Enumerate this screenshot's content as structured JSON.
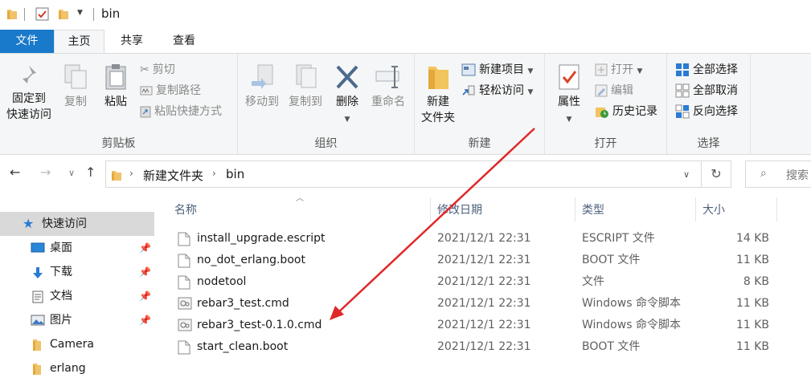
{
  "window": {
    "title": "bin"
  },
  "tabs": [
    {
      "label": "文件"
    },
    {
      "label": "主页"
    },
    {
      "label": "共享"
    },
    {
      "label": "查看"
    }
  ],
  "ribbon": {
    "clipboard": {
      "group_label": "剪贴板",
      "pin_quick_access_line1": "固定到",
      "pin_quick_access_line2": "快速访问",
      "copy": "复制",
      "paste": "粘贴",
      "cut": "剪切",
      "copy_path": "复制路径",
      "paste_shortcut": "粘贴快捷方式"
    },
    "organize": {
      "group_label": "组织",
      "move_to": "移动到",
      "copy_to": "复制到",
      "delete": "删除",
      "rename": "重命名"
    },
    "new": {
      "group_label": "新建",
      "new_folder_line1": "新建",
      "new_folder_line2": "文件夹",
      "new_item": "新建项目",
      "easy_access": "轻松访问"
    },
    "open": {
      "group_label": "打开",
      "properties": "属性",
      "open": "打开",
      "edit": "编辑",
      "history": "历史记录"
    },
    "select": {
      "group_label": "选择",
      "select_all": "全部选择",
      "select_none": "全部取消",
      "invert_selection": "反向选择"
    }
  },
  "address": {
    "crumbs": [
      "新建文件夹",
      "bin"
    ]
  },
  "search": {
    "placeholder": "搜索"
  },
  "sidebar": {
    "items": [
      {
        "label": "快速访问",
        "icon": "star-icon"
      },
      {
        "label": "桌面",
        "icon": "desktop-icon",
        "pinned": true
      },
      {
        "label": "下载",
        "icon": "download-icon",
        "pinned": true
      },
      {
        "label": "文档",
        "icon": "document-icon",
        "pinned": true
      },
      {
        "label": "图片",
        "icon": "picture-icon",
        "pinned": true
      },
      {
        "label": "Camera",
        "icon": "folder-icon"
      },
      {
        "label": "erlang",
        "icon": "folder-icon"
      }
    ]
  },
  "columns": {
    "name": "名称",
    "date": "修改日期",
    "type": "类型",
    "size": "大小"
  },
  "files": [
    {
      "name": "install_upgrade.escript",
      "date": "2021/12/1 22:31",
      "type": "ESCRIPT 文件",
      "size": "14 KB",
      "icon": "file-icon"
    },
    {
      "name": "no_dot_erlang.boot",
      "date": "2021/12/1 22:31",
      "type": "BOOT 文件",
      "size": "11 KB",
      "icon": "file-icon"
    },
    {
      "name": "nodetool",
      "date": "2021/12/1 22:31",
      "type": "文件",
      "size": "8 KB",
      "icon": "file-icon"
    },
    {
      "name": "rebar3_test.cmd",
      "date": "2021/12/1 22:31",
      "type": "Windows 命令脚本",
      "size": "11 KB",
      "icon": "cmd-file-icon"
    },
    {
      "name": "rebar3_test-0.1.0.cmd",
      "date": "2021/12/1 22:31",
      "type": "Windows 命令脚本",
      "size": "11 KB",
      "icon": "cmd-file-icon"
    },
    {
      "name": "start_clean.boot",
      "date": "2021/12/1 22:31",
      "type": "BOOT 文件",
      "size": "11 KB",
      "icon": "file-icon"
    }
  ],
  "annotation": {
    "arrow_color": "#e0282a"
  }
}
